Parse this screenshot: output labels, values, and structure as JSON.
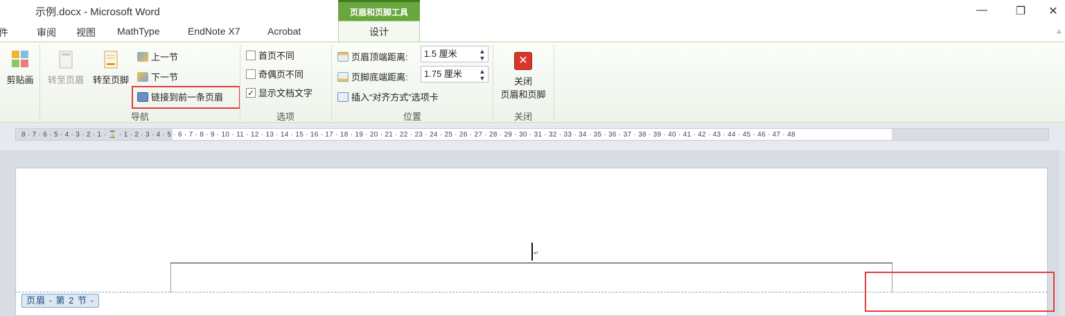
{
  "window": {
    "title": "示例.docx - Microsoft Word",
    "context_tab": "页眉和页脚工具",
    "minimize_glyph": "—",
    "restore_glyph": "❐",
    "close_glyph": "✕"
  },
  "tabs": [
    {
      "label": "邮件"
    },
    {
      "label": "审阅"
    },
    {
      "label": "视图"
    },
    {
      "label": "MathType"
    },
    {
      "label": "EndNote X7"
    },
    {
      "label": "Acrobat"
    }
  ],
  "active_tab": "设计",
  "collapse_glyph": "▵",
  "ribbon": {
    "insert_group": {
      "clipart": "剪贴画"
    },
    "navigation": {
      "label": "导航",
      "goto_header": "转至页眉",
      "goto_footer": "转至页脚",
      "prev_section": "上一节",
      "next_section": "下一节",
      "link_previous": "链接到前一条页眉"
    },
    "options": {
      "label": "选项",
      "first_page_diff": "首页不同",
      "odd_even_diff": "奇偶页不同",
      "show_doc_text": "显示文档文字",
      "show_doc_text_checked": "✓"
    },
    "position": {
      "label": "位置",
      "header_top_label": "页眉顶端距离:",
      "header_top_value": "1.5 厘米",
      "footer_bottom_label": "页脚底端距离:",
      "footer_bottom_value": "1.75 厘米",
      "insert_align_tab": "插入“对齐方式”选项卡",
      "spin_glyph": "▲▼"
    },
    "close": {
      "label": "关闭",
      "button_line1": "关闭",
      "button_line2": "页眉和页脚",
      "icon_glyph": "✕"
    }
  },
  "ruler": {
    "ticks": "8 · 7 · 6 · 5 · 4 · 3 · 2 · 1 · ⌛ · 1 · 2 · 3 · 4 · 5 · 6 · 7 · 8 · 9 · 10 · 11 · 12 · 13 · 14 · 15 · 16 · 17 · 18 · 19 · 20 · 21 · 22 · 23 · 24 · 25 · 26 · 27 · 28 · 29 · 30 · 31 · 32 · 33 · 34 · 35 · 36 · 37 · 38 · 39 · 40 · 41 · 42 · 43 · 44 · 45 · 46 · 47 · 48"
  },
  "document": {
    "header_tag": "页眉 - 第 2 节 -",
    "paragraph_mark": "↵"
  },
  "colors": {
    "context_tab": "#6aa63e",
    "highlight": "#e23b3b",
    "header_dash": "#7fa8c9"
  }
}
